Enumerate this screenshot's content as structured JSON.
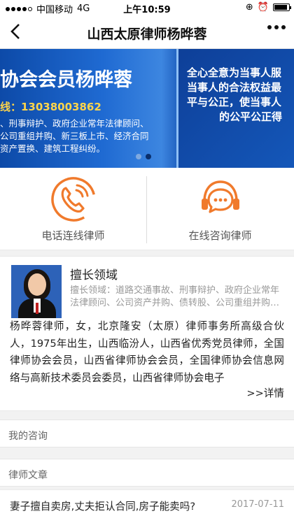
{
  "status_bar": {
    "carrier": "中国移动",
    "network": "4G",
    "time": "上午10:59"
  },
  "navbar": {
    "title": "山西太原律师杨晔蓉",
    "back_icon": "chevron-left-icon",
    "more_icon": "more-dots-icon"
  },
  "banner": {
    "headline": "协会会员杨晔蓉",
    "phone": "线：13038003862",
    "desc_line1": "、刑事辩护、政府企业常年法律顾问、",
    "desc_line2": "公司重组并购、新三板上市、经济合同",
    "desc_line3": "资产置换、建筑工程纠纷。",
    "slogan_line1": "全心全意为当事人服",
    "slogan_line2": "当事人的合法权益最",
    "slogan_line3": "平与公正，使当事人",
    "slogan_line4": "的公平公正得",
    "slide_count": 2,
    "active_slide": 1
  },
  "actions": [
    {
      "label": "电话连线律师",
      "icon": "phone-icon"
    },
    {
      "label": "在线咨询律师",
      "icon": "headset-chat-icon"
    }
  ],
  "profile": {
    "heading": "擅长领域",
    "specialties": "擅长领域：道路交通事故、刑事辩护、政府企业常年法律顾问、公司资产并购、债转股、公司重组并购、新三板上市、经济合同纠纷",
    "bio": "杨晔蓉律师，女，北京隆安（太原）律师事务所高级合伙人，1975年出生，山西临汾人，山西省优秀党员律师，全国律师协会会员，山西省律师协会会员，全国律师协会信息网络与高新技术委员会委员，山西省律师协会电子",
    "more_label": ">>详情"
  },
  "sections": {
    "consult_title": "我的咨询",
    "articles_title": "律师文章"
  },
  "articles": [
    {
      "title": "妻子擅自卖房,丈夫拒认合同,房子能卖吗?",
      "date": "2017-07-11"
    }
  ],
  "colors": {
    "accent_orange": "#f07a2c",
    "banner_blue": "#1a5cc0"
  }
}
